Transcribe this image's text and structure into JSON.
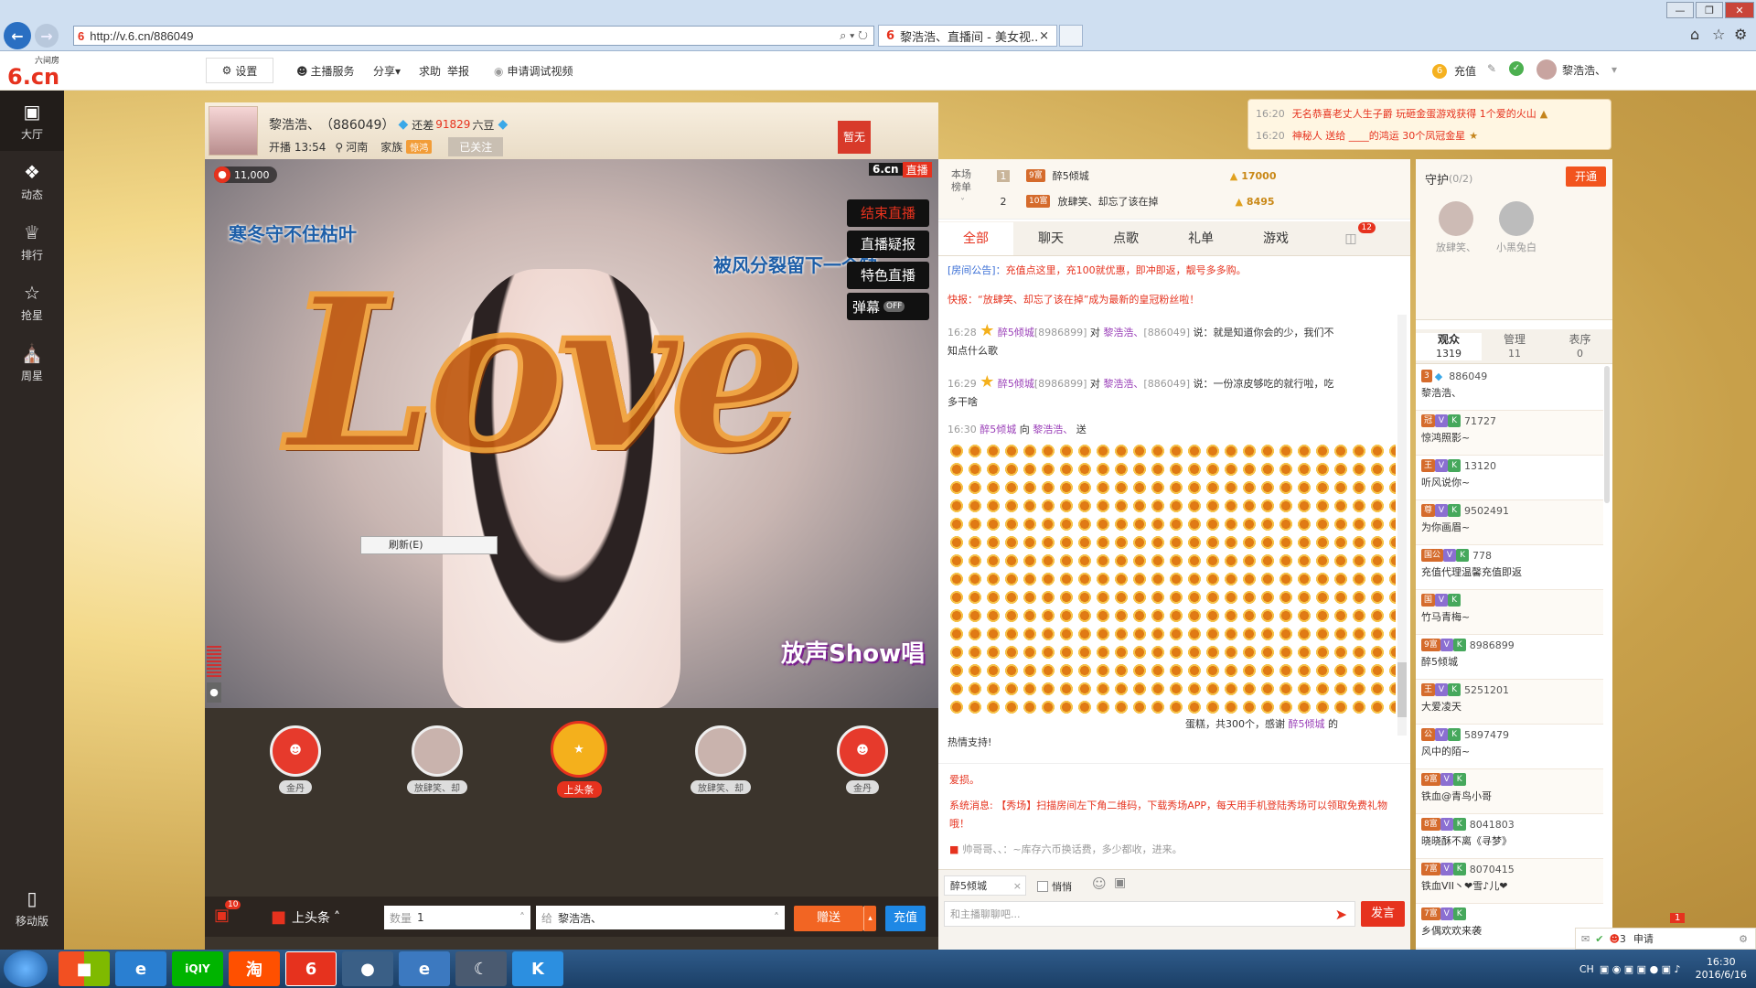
{
  "browser": {
    "url": "http://v.6.cn/886049",
    "tab_title": "黎浩浩、直播间 - 美女视...",
    "tab_close": "×",
    "search_glyph": "⌕ ▾ ↻"
  },
  "header": {
    "logo_top": "六间房",
    "logo_main": "6.cn",
    "settings": "设置",
    "anchor_service": "主播服务",
    "share": "分享",
    "help": "求助",
    "report": "举报",
    "apply_debug": "申请调试视频",
    "recharge": "充值",
    "user_name": "黎浩浩、"
  },
  "sidebar": {
    "items": [
      {
        "label": "大厅",
        "icon": "tv-icon"
      },
      {
        "label": "动态",
        "icon": "compass-icon"
      },
      {
        "label": "排行",
        "icon": "crown-icon"
      },
      {
        "label": "抢星",
        "icon": "star-icon"
      },
      {
        "label": "周星",
        "icon": "gift-box-icon"
      }
    ],
    "mobile": "移动版"
  },
  "host": {
    "name": "黎浩浩、",
    "room_id": "（886049）",
    "remain_prefix": "还差",
    "remain_value": "91829",
    "remain_suffix": "六豆",
    "start_label": "开播 13:54",
    "location": "河南",
    "family_label": "家族",
    "family_badge": "惊鸿",
    "follow": "已关注",
    "nodata": "暂无"
  },
  "video": {
    "viewers": "11,000",
    "watermark": "6.cn",
    "live_tag": "直播",
    "lyric1": "寒冬守不住枯叶",
    "lyric2": "被风分裂留下一个缺",
    "menu": [
      "结束直播",
      "直播疑报",
      "特色直播"
    ],
    "danmu_label": "弹幕",
    "danmu_toggle": "OFF",
    "refresh": "刷新(E)",
    "show_logo": "放声Show唱",
    "love_text": "Love"
  },
  "gifts": [
    {
      "label": "金丹"
    },
    {
      "label": "放肆笑、却"
    },
    {
      "label": "上头条"
    },
    {
      "label": "放肆笑、却"
    },
    {
      "label": "金丹"
    }
  ],
  "bottom_bar": {
    "wallet_badge": "10",
    "headline": "上头条",
    "qty_label": "数量",
    "qty_value": "1",
    "to_label": "给",
    "to_value": "黎浩浩、",
    "send": "赠送",
    "recharge": "充值"
  },
  "rank": {
    "title": "本场榜单",
    "rows": [
      {
        "rank": "1",
        "level": "9富",
        "name": "醉5倾城",
        "score": "17000"
      },
      {
        "rank": "2",
        "level": "10富",
        "name": "放肆笑、却忘了该在掉",
        "score": "8495"
      }
    ]
  },
  "chat_tabs": [
    "全部",
    "聊天",
    "点歌",
    "礼单",
    "游戏"
  ],
  "chat_tab_badge": "12",
  "chat": {
    "notice_label": "[房间公告]：",
    "notice": "充值点这里，充100就优惠，即冲即返，靓号多多购。",
    "flash": "快报：“放肆笑、却忘了该在掉”成为最新的皇冠粉丝啦！",
    "msg1_time": "16:28",
    "msg1_user": "醉5倾城",
    "msg1_uid": "[8986899]",
    "msg1_to": "对",
    "msg1_target": "黎浩浩、",
    "msg1_tuid": "[886049]",
    "msg1_say": "说：就是知道你会的少，我们不",
    "msg1_cont": "知点什么歌",
    "msg2_time": "16:29",
    "msg2_user": "醉5倾城",
    "msg2_uid": "[8986899]",
    "msg2_to": "对",
    "msg2_target": "黎浩浩、",
    "msg2_tuid": "[886049]",
    "msg2_say": "说：一份凉皮够吃的就行啦，吃",
    "msg2_cont": "多干啥",
    "msg3_time": "16:30",
    "msg3_user": "醉5倾城",
    "msg3_to": "向",
    "msg3_target": "黎浩浩、",
    "msg3_send": "送",
    "msg3_tail": "蛋糕，共300个，感谢",
    "msg3_tail_user": "醉5倾城",
    "msg3_tail_end": "的",
    "msg3_end": "热情支持!",
    "lower1": "爱损。",
    "lower2_label": "系统消息:",
    "lower2": "【秀场】扫描房间左下角二维码，下载秀场APP，每天用手机登陆秀场可以领取免费礼物哦！",
    "lower3": "帅哥哥、、：~库存六币换话费，多少都收，进来。",
    "target_user": "醉5倾城",
    "whisper": "悄悄",
    "input_placeholder": "和主播聊聊吧...",
    "send": "发言"
  },
  "notices": [
    {
      "time": "16:20",
      "text": "无名恭喜老丈人生子爵 玩砸金蛋游戏获得 1个爱的火山"
    },
    {
      "time": "16:20",
      "text": "神秘人 送给 ____的鸿运 30个凤冠金星"
    }
  ],
  "guard": {
    "title": "守护",
    "count": "(0/2)",
    "open": "开通",
    "members": [
      "放肆笑、",
      "小黑兔白"
    ]
  },
  "audience_tabs": [
    {
      "label": "观众",
      "count": "1319"
    },
    {
      "label": "管理",
      "count": "11"
    },
    {
      "label": "表序",
      "count": "0"
    }
  ],
  "audience": [
    {
      "id": "886049",
      "name": "黎浩浩、",
      "level": "3"
    },
    {
      "id": "71727",
      "name": "惊鸿照影~",
      "level": "冠"
    },
    {
      "id": "13120",
      "name": "听风说你~",
      "level": "王"
    },
    {
      "id": "9502491",
      "name": "为你画眉~",
      "level": "尊"
    },
    {
      "id": "778",
      "name": "充值代理温馨充值即返",
      "level": "国公"
    },
    {
      "id": "",
      "name": "竹马青梅~",
      "level": "国"
    },
    {
      "id": "8986899",
      "name": "醉5倾城",
      "level": "9富"
    },
    {
      "id": "5251201",
      "name": "大爱凌天",
      "level": "王"
    },
    {
      "id": "5897479",
      "name": "风中的陌~",
      "level": "公"
    },
    {
      "id": "",
      "name": "铁血@青鸟小哥",
      "level": "9富"
    },
    {
      "id": "8041803",
      "name": "晓晓酥不离《寻梦》",
      "level": "8富"
    },
    {
      "id": "8070415",
      "name": "铁血VII丶❤雪♪儿❤",
      "level": "7富"
    },
    {
      "id": "",
      "name": "乡偶欢欢来袭",
      "level": "7富"
    }
  ],
  "right_bottom": {
    "badge": "1",
    "apply": "申请",
    "mail_count": "3"
  },
  "taskbar": {
    "time": "16:30",
    "date": "2016/6/16",
    "lang": "CH"
  },
  "colors": {
    "accent": "#f26523",
    "chat_red": "#e6321e",
    "chat_blue": "#3b6fd6",
    "sidebar": "#2d2724"
  }
}
